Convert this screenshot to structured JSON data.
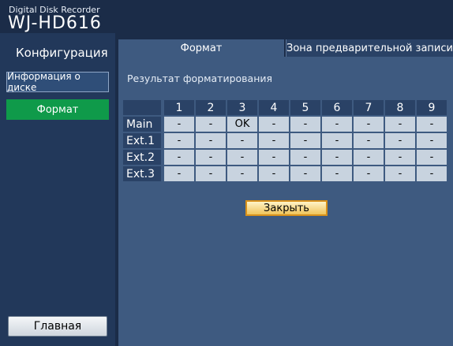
{
  "header": {
    "brand": "Digital Disk Recorder",
    "model": "WJ-HD616"
  },
  "sidebar": {
    "title": "Конфигурация",
    "items": [
      {
        "label": "Информация о диске"
      },
      {
        "label": "Формат"
      }
    ],
    "home_label": "Главная"
  },
  "tabs": [
    {
      "label": "Формат"
    },
    {
      "label": "Зона предварительной записи"
    }
  ],
  "main": {
    "result_label": "Результат форматирования",
    "columns": [
      "1",
      "2",
      "3",
      "4",
      "5",
      "6",
      "7",
      "8",
      "9"
    ],
    "rows": [
      {
        "label": "Main",
        "values": [
          "-",
          "-",
          "OK",
          "-",
          "-",
          "-",
          "-",
          "-",
          "-"
        ]
      },
      {
        "label": "Ext.1",
        "values": [
          "-",
          "-",
          "-",
          "-",
          "-",
          "-",
          "-",
          "-",
          "-"
        ]
      },
      {
        "label": "Ext.2",
        "values": [
          "-",
          "-",
          "-",
          "-",
          "-",
          "-",
          "-",
          "-",
          "-"
        ]
      },
      {
        "label": "Ext.3",
        "values": [
          "-",
          "-",
          "-",
          "-",
          "-",
          "-",
          "-",
          "-",
          "-"
        ]
      }
    ],
    "close_label": "Закрыть"
  }
}
